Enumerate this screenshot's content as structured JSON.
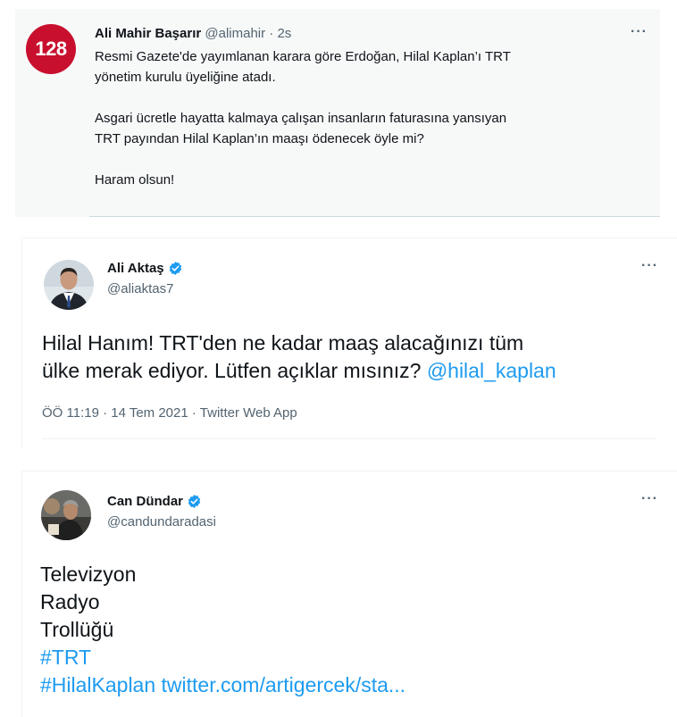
{
  "tweet1": {
    "avatar_text": "128",
    "name": "Ali Mahir Başarır",
    "meta": " @alimahir · 2s",
    "more": "···",
    "paragraphs": [
      "Resmi Gazete'de yayımlanan karara göre Erdoğan, Hilal Kaplan’ı TRT\nyönetim kurulu üyeliğine atadı.",
      "Asgari ücretle hayatta kalmaya çalışan insanların faturasına yansıyan\nTRT payından Hilal Kaplan’ın maaşı ödenecek öyle mi?",
      "Haram olsun!"
    ]
  },
  "tweet2": {
    "name": "Ali Aktaş",
    "handle": "@aliaktas7",
    "more": "···",
    "text_line1": "Hilal Hanım! TRT'den ne kadar maaş alacağınızı tüm",
    "text_line2": "ülke merak ediyor. Lütfen açıklar mısınız? ",
    "mention": "@hilal_kaplan",
    "footer": "ÖÖ 11:19 · 14 Tem 2021 · Twitter Web App"
  },
  "tweet3": {
    "name": "Can Dündar",
    "handle": "@candundaradasi",
    "more": "···",
    "lines": [
      "Televizyon",
      "Radyo",
      "Trollüğü"
    ],
    "hashtag1": "#TRT",
    "hashtag2_line": "#HilalKaplan twitter.com/artigercek/sta..."
  },
  "colors": {
    "link": "#1d9bf0",
    "verified": "#1d9bf0",
    "logo_red": "#c8102e"
  }
}
